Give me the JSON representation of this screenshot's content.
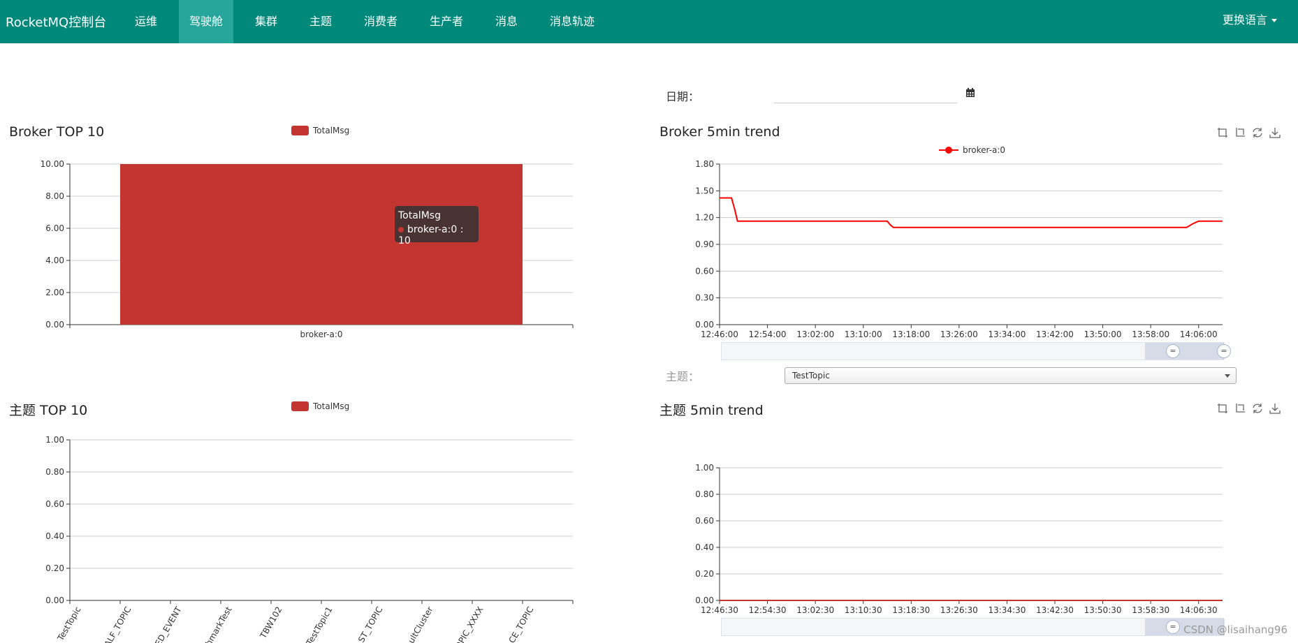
{
  "nav": {
    "brand": "RocketMQ控制台",
    "items": [
      {
        "label": "运维"
      },
      {
        "label": "驾驶舱"
      },
      {
        "label": "集群"
      },
      {
        "label": "主题"
      },
      {
        "label": "消费者"
      },
      {
        "label": "生产者"
      },
      {
        "label": "消息"
      },
      {
        "label": "消息轨迹"
      }
    ],
    "active": "驾驶舱",
    "language": "更换语言"
  },
  "date_filter": {
    "label": "日期：",
    "value": ""
  },
  "topic_filter": {
    "label": "主题：",
    "selected": "TestTopic"
  },
  "colors": {
    "navbar": "#00897b",
    "active_nav": "#26a69a",
    "series": "#c23531",
    "line": "#ff0000"
  },
  "panels": {
    "broker_top": {
      "title": "Broker TOP 10"
    },
    "broker_trend": {
      "title": "Broker 5min trend"
    },
    "topic_top": {
      "title": "主题 TOP 10"
    },
    "topic_trend": {
      "title": "主题 5min trend"
    }
  },
  "tooltip": {
    "title": "TotalMsg",
    "line": "broker-a:0 : 10"
  },
  "watermark": "CSDN @lisaihang96",
  "chart_data": [
    {
      "type": "bar",
      "title": "Broker TOP 10",
      "categories": [
        "broker-a:0"
      ],
      "series": [
        {
          "name": "TotalMsg",
          "values": [
            10
          ]
        }
      ],
      "ylim": [
        0,
        10
      ],
      "yticks": [
        "0.00",
        "2.00",
        "4.00",
        "6.00",
        "8.00",
        "10.00"
      ],
      "grid": true,
      "legend": "top-center"
    },
    {
      "type": "line",
      "title": "Broker 5min trend",
      "x": [
        "12:46:00",
        "12:48:00",
        "12:48:30",
        "12:49:00",
        "13:00:00",
        "13:10:00",
        "13:14:00",
        "13:14:30",
        "13:15:00",
        "13:30:00",
        "13:50:00",
        "14:04:00",
        "14:05:00",
        "14:06:00",
        "14:10:00"
      ],
      "xticks": [
        "12:46:00",
        "12:54:00",
        "13:02:00",
        "13:10:00",
        "13:18:00",
        "13:26:00",
        "13:34:00",
        "13:42:00",
        "13:50:00",
        "13:58:00",
        "14:06:00"
      ],
      "series": [
        {
          "name": "broker-a:0",
          "values": [
            1.42,
            1.42,
            1.3,
            1.16,
            1.16,
            1.16,
            1.16,
            1.12,
            1.09,
            1.09,
            1.09,
            1.09,
            1.13,
            1.16,
            1.16
          ]
        }
      ],
      "ylim": [
        0,
        1.8
      ],
      "yticks": [
        "0.00",
        "0.30",
        "0.60",
        "0.90",
        "1.20",
        "1.50",
        "1.80"
      ],
      "grid": true,
      "legend": "top-center"
    },
    {
      "type": "bar",
      "title": "主题 TOP 10",
      "categories": [
        "TestTopic",
        "...ALF_TOPIC",
        "...ED_EVENT",
        "...hmarkTest",
        "TBW102",
        "TestTopic1",
        "...ST_TOPIC",
        "...faultCluster",
        "...OPIC_XXXX",
        "...CE_TOPIC"
      ],
      "series": [
        {
          "name": "TotalMsg",
          "values": [
            0,
            0,
            0,
            0,
            0,
            0,
            0,
            0,
            0,
            0
          ]
        }
      ],
      "ylim": [
        0,
        1
      ],
      "yticks": [
        "0.00",
        "0.20",
        "0.40",
        "0.60",
        "0.80",
        "1.00"
      ],
      "grid": true,
      "legend": "top-center"
    },
    {
      "type": "line",
      "title": "主题 5min trend",
      "x": [
        "12:46:30",
        "14:10:30"
      ],
      "xticks": [
        "12:46:30",
        "12:54:30",
        "13:02:30",
        "13:10:30",
        "13:18:30",
        "13:26:30",
        "13:34:30",
        "13:42:30",
        "13:50:30",
        "13:58:30",
        "14:06:30"
      ],
      "series": [
        {
          "values": [
            0,
            0
          ]
        }
      ],
      "ylim": [
        0,
        1
      ],
      "yticks": [
        "0.00",
        "0.20",
        "0.40",
        "0.60",
        "0.80",
        "1.00"
      ],
      "grid": true
    }
  ]
}
